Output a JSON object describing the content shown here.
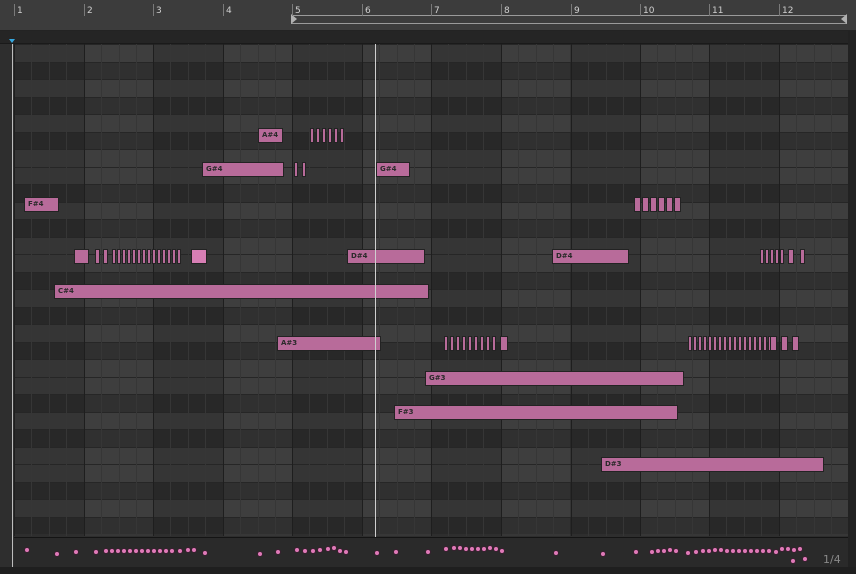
{
  "ruler": {
    "bar_numbers": [
      "1",
      "2",
      "3",
      "4",
      "5",
      "6",
      "7",
      "8",
      "9",
      "10",
      "11",
      "12"
    ]
  },
  "grid_resolution": "1/4",
  "colors": {
    "note": "#b86b9a",
    "velocity": "#e07ab8",
    "playhead": "#cfcfcf",
    "start_marker": "#35a8e0"
  },
  "labeled_notes": [
    {
      "pitch": "A#4",
      "label": "A#4"
    },
    {
      "pitch": "G#4",
      "label": "G#4"
    },
    {
      "pitch": "G#4",
      "label": "G#4"
    },
    {
      "pitch": "F#4",
      "label": "F#4"
    },
    {
      "pitch": "D#4",
      "label": "D#4"
    },
    {
      "pitch": "D#4",
      "label": "D#4"
    },
    {
      "pitch": "C#4",
      "label": "C#4"
    },
    {
      "pitch": "A#3",
      "label": "A#3"
    },
    {
      "pitch": "G#3",
      "label": "G#3"
    },
    {
      "pitch": "F#3",
      "label": "F#3"
    },
    {
      "pitch": "D#3",
      "label": "D#3"
    }
  ]
}
